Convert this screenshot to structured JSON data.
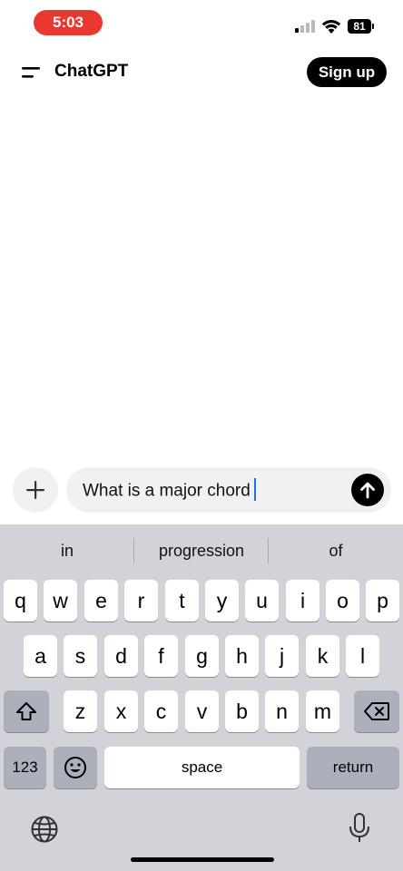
{
  "status_bar": {
    "time": "5:03",
    "battery": "81"
  },
  "header": {
    "title": "ChatGPT",
    "signup_label": "Sign up"
  },
  "composer": {
    "input_value": "What is a major chord"
  },
  "keyboard": {
    "suggestions": [
      "in",
      "progression",
      "of"
    ],
    "row1": [
      "q",
      "w",
      "e",
      "r",
      "t",
      "y",
      "u",
      "i",
      "o",
      "p"
    ],
    "row2": [
      "a",
      "s",
      "d",
      "f",
      "g",
      "h",
      "j",
      "k",
      "l"
    ],
    "row3": [
      "z",
      "x",
      "c",
      "v",
      "b",
      "n",
      "m"
    ],
    "numbers_label": "123",
    "space_label": "space",
    "return_label": "return"
  },
  "colors": {
    "time_pill": "#e8382f",
    "keyboard_bg": "#d1d3d9",
    "caret": "#1a73e8"
  }
}
